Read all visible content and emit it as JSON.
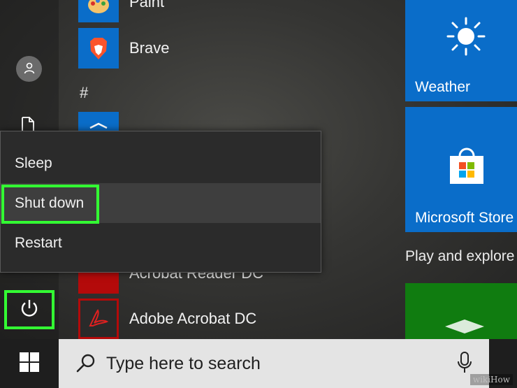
{
  "apps": {
    "paint": {
      "label": "Paint"
    },
    "brave": {
      "label": "Brave"
    },
    "section_hash": "#",
    "acrobat_reader": {
      "label": "Acrobat Reader DC"
    },
    "adobe_acrobat": {
      "label": "Adobe Acrobat DC"
    }
  },
  "power_menu": {
    "items": [
      {
        "label": "Sleep"
      },
      {
        "label": "Shut down"
      },
      {
        "label": "Restart"
      }
    ],
    "highlight_color": "#33ff33"
  },
  "tiles": {
    "weather": {
      "label": "Weather"
    },
    "store": {
      "label": "Microsoft Store"
    },
    "group_label": "Play and explore"
  },
  "taskbar": {
    "search_placeholder": "Type here to search"
  },
  "watermark": "wikiHow",
  "colors": {
    "tile_blue": "#0a6dc9",
    "tile_green": "#107c10",
    "highlight": "#33ff33"
  }
}
